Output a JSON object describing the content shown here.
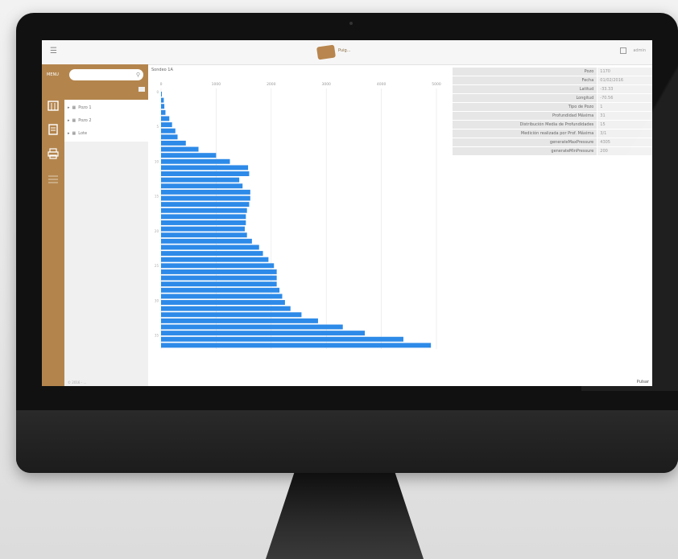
{
  "app": {
    "logo_text": "Puig...",
    "user_label": "admin"
  },
  "sidebar": {
    "menu_label": "MENU",
    "icons": [
      "calendar-icon",
      "document-icon",
      "printer-icon",
      "list-icon"
    ]
  },
  "panel": {
    "search_placeholder": "",
    "tree": [
      {
        "label": "Pozo 1"
      },
      {
        "label": "Pozo 2"
      },
      {
        "label": "Lote"
      }
    ],
    "footer": "© 2016 - ..."
  },
  "chart_section": {
    "title": "Sondeo 1A",
    "status": "Pulsar"
  },
  "info_table": [
    {
      "key": "Pozo",
      "value": "1170"
    },
    {
      "key": "Fecha",
      "value": "01/02/2016"
    },
    {
      "key": "Latitud",
      "value": "-33.33"
    },
    {
      "key": "Longitud",
      "value": "-70.56"
    },
    {
      "key": "Tipo de Pozo",
      "value": "1"
    },
    {
      "key": "Profundidad Máxima",
      "value": "31"
    },
    {
      "key": "Distribución Media de Profundidades",
      "value": "15"
    },
    {
      "key": "Medición realizada por Prof. Máxima",
      "value": "3/1"
    },
    {
      "key": "generateMaxPressure",
      "value": "4305"
    },
    {
      "key": "generateMinPressure",
      "value": "200"
    }
  ],
  "colors": {
    "brand": "#b3854d",
    "bar": "#2d8ae8"
  },
  "chart_data": {
    "type": "bar",
    "orientation": "horizontal",
    "xticks": [
      "0",
      "1000",
      "2000",
      "3000",
      "4000",
      "5000"
    ],
    "xlim": [
      0,
      5000
    ],
    "yticks": [
      "0",
      "5",
      "10",
      "15",
      "20",
      "25",
      "30",
      "35"
    ],
    "ylim": [
      0,
      37
    ],
    "values": [
      10,
      50,
      60,
      80,
      150,
      200,
      260,
      300,
      450,
      680,
      1000,
      1250,
      1580,
      1600,
      1420,
      1480,
      1620,
      1620,
      1600,
      1560,
      1540,
      1540,
      1520,
      1560,
      1650,
      1780,
      1850,
      1950,
      2050,
      2100,
      2100,
      2100,
      2150,
      2200,
      2250,
      2350,
      2550,
      2850,
      3300,
      3700,
      4400,
      4900
    ]
  }
}
